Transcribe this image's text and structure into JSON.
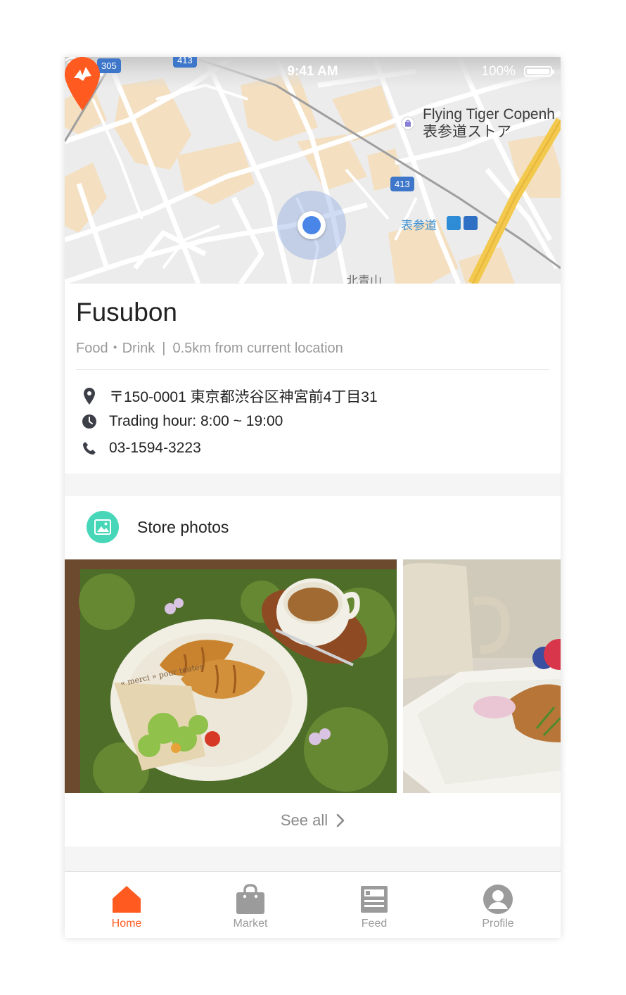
{
  "status_bar": {
    "signal": "●●●●●",
    "time": "9:41 AM",
    "battery": "100%"
  },
  "map": {
    "store_label_line1": "Flying Tiger Copenh",
    "store_label_line2": "表参道ストア",
    "station_label": "表参道",
    "area_label": "北青山",
    "route_badges": [
      "305",
      "413",
      "413"
    ],
    "pin_color": "#ff5a1f",
    "location_color": "#4a86e8"
  },
  "store": {
    "name": "Fusubon",
    "category": "Food・Drink",
    "distance": "0.5km from current location",
    "meta_separator": "|",
    "address": "〒150-0001 東京都渋谷区神宮前4丁目31",
    "hours": "Trading hour: 8:00 ~ 19:00",
    "phone": "03-1594-3223"
  },
  "photos": {
    "title": "Store photos",
    "icon": "image-icon",
    "icon_color": "#47d7b8",
    "see_all": "See all"
  },
  "tabbar": {
    "accent": "#ff5a1f",
    "inactive": "#9b9b9b",
    "tabs": [
      {
        "label": "Home",
        "icon": "home-icon",
        "active": true
      },
      {
        "label": "Market",
        "icon": "bag-icon",
        "active": false
      },
      {
        "label": "Feed",
        "icon": "feed-icon",
        "active": false
      },
      {
        "label": "Profile",
        "icon": "profile-icon",
        "active": false
      }
    ]
  }
}
